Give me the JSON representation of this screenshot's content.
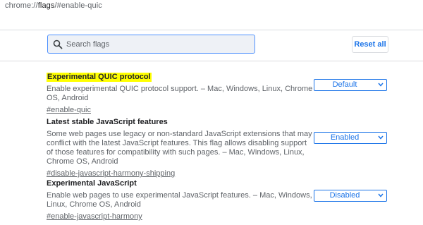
{
  "omnibox": {
    "scheme": "chrome://",
    "host": "flags",
    "path": "/#enable-quic"
  },
  "toolbar": {
    "search_placeholder": "Search flags",
    "search_value": "",
    "reset_label": "Reset all",
    "accent_color": "#1a73e8"
  },
  "flags": [
    {
      "title": "Experimental QUIC protocol",
      "highlighted": true,
      "description": "Enable experimental QUIC protocol support. – Mac, Windows, Linux, Chrome OS, Android",
      "link": "#enable-quic",
      "state": "Default"
    },
    {
      "title": "Latest stable JavaScript features",
      "highlighted": false,
      "description": "Some web pages use legacy or non-standard JavaScript extensions that may conflict with the latest JavaScript features. This flag allows disabling support of those features for compatibility with such pages. – Mac, Windows, Linux, Chrome OS, Android",
      "link": "#disable-javascript-harmony-shipping",
      "state": "Enabled"
    },
    {
      "title": "Experimental JavaScript",
      "highlighted": false,
      "description": "Enable web pages to use experimental JavaScript features. – Mac, Windows, Linux, Chrome OS, Android",
      "link": "#enable-javascript-harmony",
      "state": "Disabled"
    }
  ]
}
